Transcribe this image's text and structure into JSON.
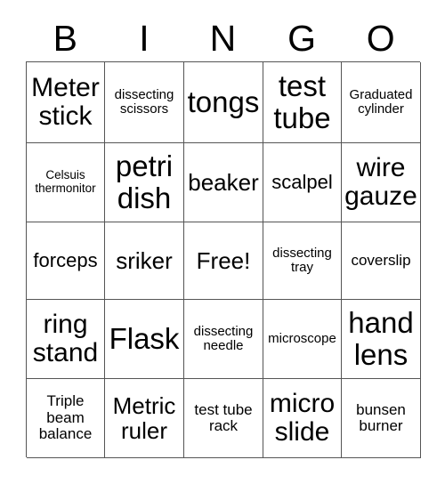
{
  "card": {
    "title": "BINGO",
    "header_letters": [
      "B",
      "I",
      "N",
      "G",
      "O"
    ],
    "columns": 5,
    "rows": 5,
    "free_space_label": "Free!",
    "free_space_position": {
      "row": 3,
      "column": 3
    },
    "colors": {
      "text": "#000000",
      "grid_line": "#555555",
      "background": "#ffffff"
    },
    "cells": [
      [
        {
          "label": "Meter stick",
          "size": "xl"
        },
        {
          "label": "dissecting scissors",
          "size": "xs"
        },
        {
          "label": "tongs",
          "size": "xxl"
        },
        {
          "label": "test tube",
          "size": "xxl"
        },
        {
          "label": "Graduated cylinder",
          "size": "xs"
        }
      ],
      [
        {
          "label": "Celsuis thermonitor",
          "size": "xxs"
        },
        {
          "label": "petri dish",
          "size": "xxl"
        },
        {
          "label": "beaker",
          "size": "l"
        },
        {
          "label": "scalpel",
          "size": "m"
        },
        {
          "label": "wire gauze",
          "size": "xl"
        }
      ],
      [
        {
          "label": "forceps",
          "size": "m"
        },
        {
          "label": "sriker",
          "size": "l"
        },
        {
          "label": "Free!",
          "size": "l"
        },
        {
          "label": "dissecting tray",
          "size": "xs"
        },
        {
          "label": "coverslip",
          "size": "s"
        }
      ],
      [
        {
          "label": "ring stand",
          "size": "xl"
        },
        {
          "label": "Flask",
          "size": "xxl"
        },
        {
          "label": "dissecting needle",
          "size": "xs"
        },
        {
          "label": "microscope",
          "size": "xs"
        },
        {
          "label": "hand lens",
          "size": "xxl"
        }
      ],
      [
        {
          "label": "Triple beam balance",
          "size": "s"
        },
        {
          "label": "Metric ruler",
          "size": "l"
        },
        {
          "label": "test tube rack",
          "size": "s"
        },
        {
          "label": "micro slide",
          "size": "xl"
        },
        {
          "label": "bunsen burner",
          "size": "s"
        }
      ]
    ]
  }
}
